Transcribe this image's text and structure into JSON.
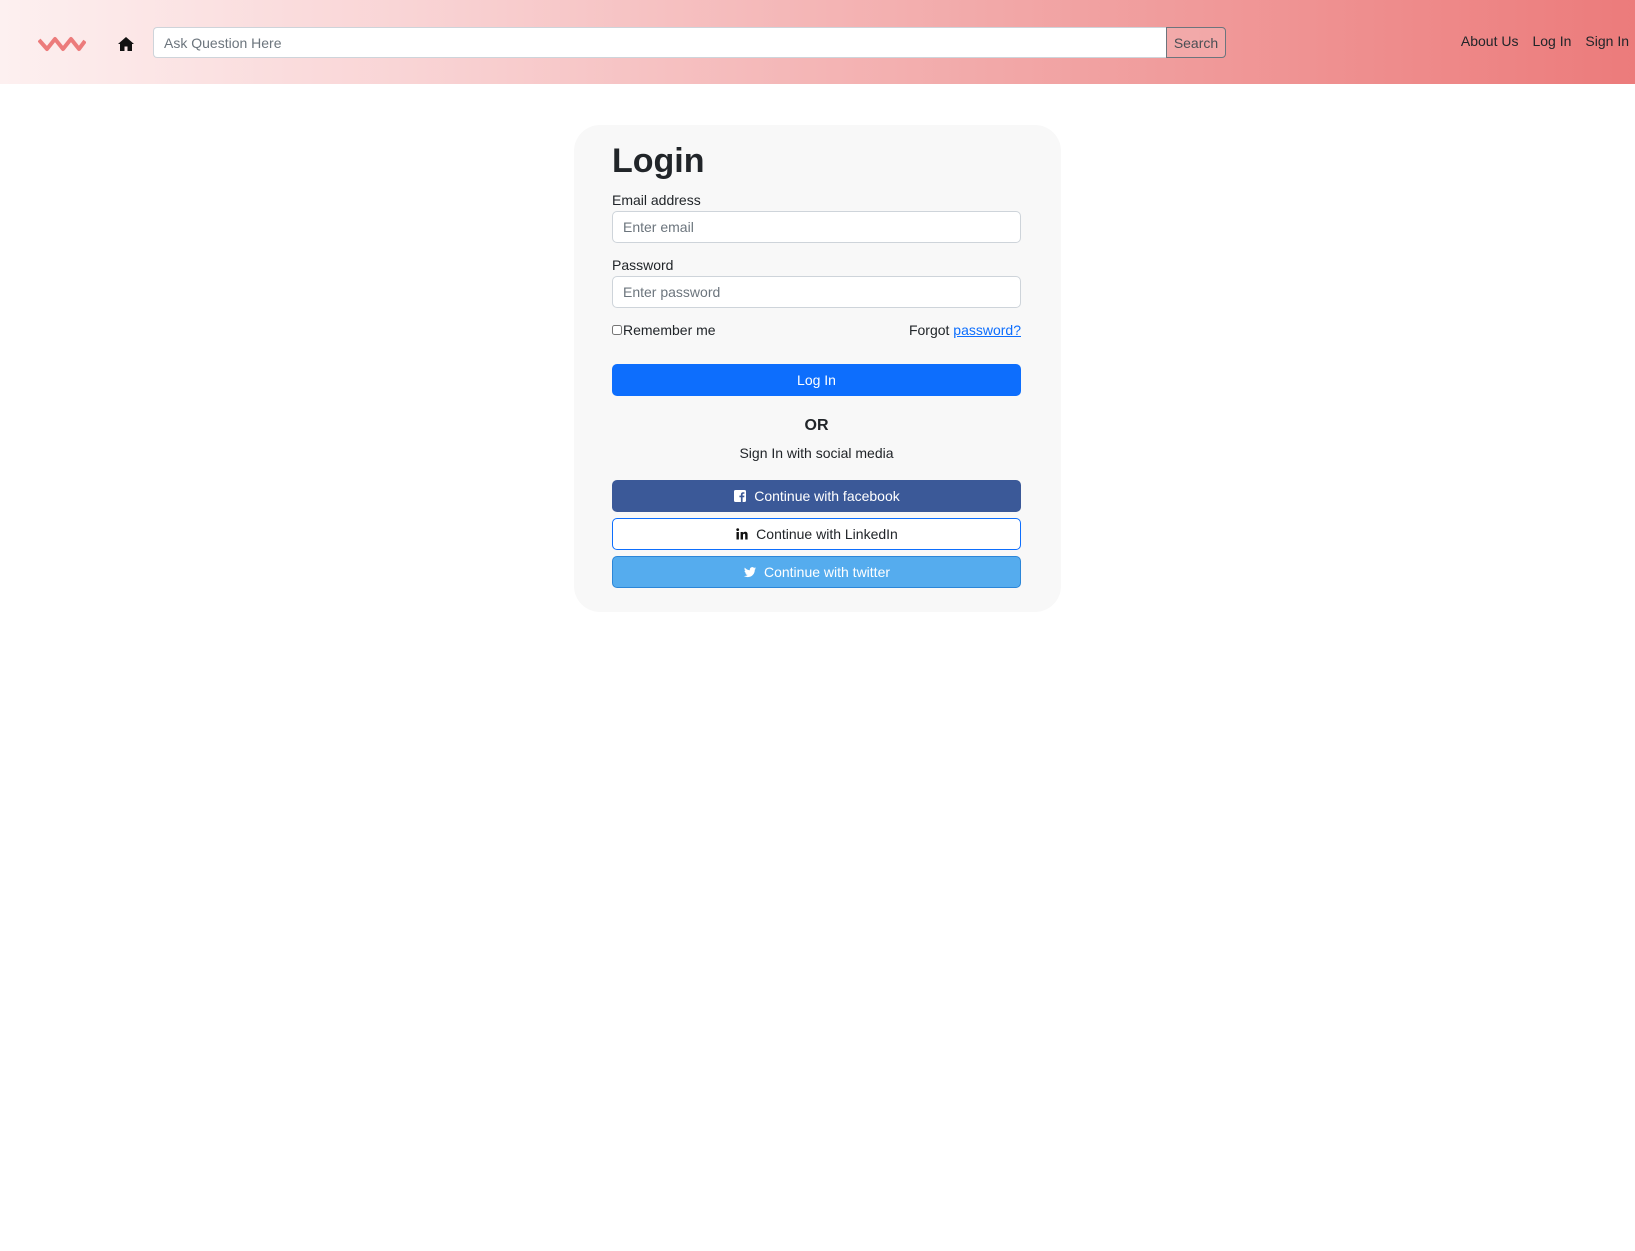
{
  "header": {
    "logo_icon": "wave-logo-icon",
    "home_icon": "home-icon",
    "search": {
      "placeholder": "Ask Question Here",
      "value": "",
      "button_label": "Search"
    },
    "nav": [
      "About Us",
      "Log In",
      "Sign In"
    ]
  },
  "login": {
    "title": "Login",
    "email_label": "Email address",
    "email_placeholder": "Enter email",
    "password_label": "Password",
    "password_placeholder": "Enter password",
    "remember_label": "Remember me",
    "remember_checked": false,
    "forgot_prefix": "Forgot",
    "forgot_link": "password?",
    "login_button": "Log In",
    "or_text": "OR",
    "social_text": "Sign In with social media",
    "social_buttons": [
      {
        "label": "Continue with facebook",
        "icon": "facebook-icon",
        "color": "#3b5998"
      },
      {
        "label": "Continue with LinkedIn",
        "icon": "linkedin-icon",
        "color": "#ffffff"
      },
      {
        "label": "Continue with twitter",
        "icon": "twitter-icon",
        "color": "#55acee"
      }
    ]
  },
  "colors": {
    "primary": "#0d6efd",
    "facebook": "#3b5998",
    "twitter": "#55acee",
    "header_gradient_end": "#ec7b7b"
  }
}
